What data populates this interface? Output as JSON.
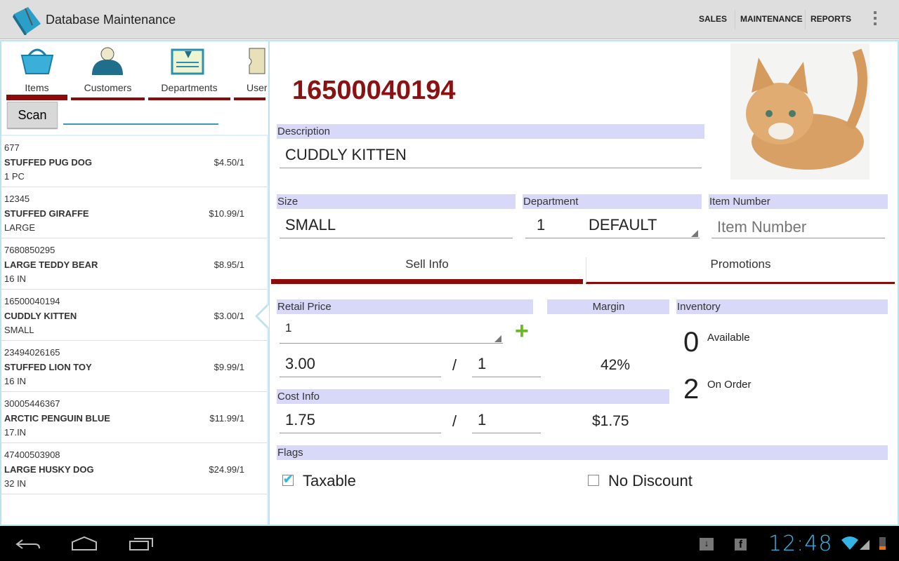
{
  "app": {
    "title": "Database Maintenance",
    "menu": [
      "SALES",
      "MAINTENANCE",
      "REPORTS"
    ]
  },
  "tabs": [
    {
      "label": "Items"
    },
    {
      "label": "Customers"
    },
    {
      "label": "Departments"
    },
    {
      "label": "User"
    }
  ],
  "scan": {
    "label": "Scan",
    "value": ""
  },
  "items": [
    {
      "code": "677",
      "name": "STUFFED PUG DOG",
      "size": "1 PC",
      "price": "$4.50/1"
    },
    {
      "code": "12345",
      "name": "STUFFED GIRAFFE",
      "size": "LARGE",
      "price": "$10.99/1"
    },
    {
      "code": "7680850295",
      "name": "LARGE TEDDY BEAR",
      "size": "16 IN",
      "price": "$8.95/1"
    },
    {
      "code": "16500040194",
      "name": "CUDDLY KITTEN",
      "size": "SMALL",
      "price": "$3.00/1"
    },
    {
      "code": "23494026165",
      "name": "STUFFED LION TOY",
      "size": "16 IN",
      "price": "$9.99/1"
    },
    {
      "code": "30005446367",
      "name": "ARCTIC PENGUIN BLUE",
      "size": "17.IN",
      "price": "$11.99/1"
    },
    {
      "code": "47400503908",
      "name": "LARGE HUSKY DOG",
      "size": "32 IN",
      "price": "$24.99/1"
    }
  ],
  "detail": {
    "code": "16500040194",
    "description_label": "Description",
    "description": "CUDDLY KITTEN",
    "size_label": "Size",
    "size": "SMALL",
    "department_label": "Department",
    "department_num": "1",
    "department_name": "DEFAULT",
    "item_number_label": "Item Number",
    "item_number_placeholder": "Item Number",
    "subtabs": [
      "Sell Info",
      "Promotions"
    ],
    "retail_label": "Retail Price",
    "retail_level": "1",
    "retail_price": "3.00",
    "retail_qty": "1",
    "margin_label": "Margin",
    "margin": "42%",
    "inventory_label": "Inventory",
    "available": "0",
    "available_label": "Available",
    "on_order": "2",
    "on_order_label": "On Order",
    "cost_label": "Cost Info",
    "cost": "1.75",
    "cost_qty": "1",
    "cost_total": "$1.75",
    "slash": "/",
    "flags_label": "Flags",
    "taxable_label": "Taxable",
    "taxable": true,
    "no_discount_label": "No Discount",
    "no_discount": false
  },
  "status": {
    "time": "12:48"
  },
  "colors": {
    "accent": "#8b0a0a",
    "header_bg": "#d8d8f8",
    "frame": "#bfe3ee",
    "clock": "#33b5e5"
  }
}
